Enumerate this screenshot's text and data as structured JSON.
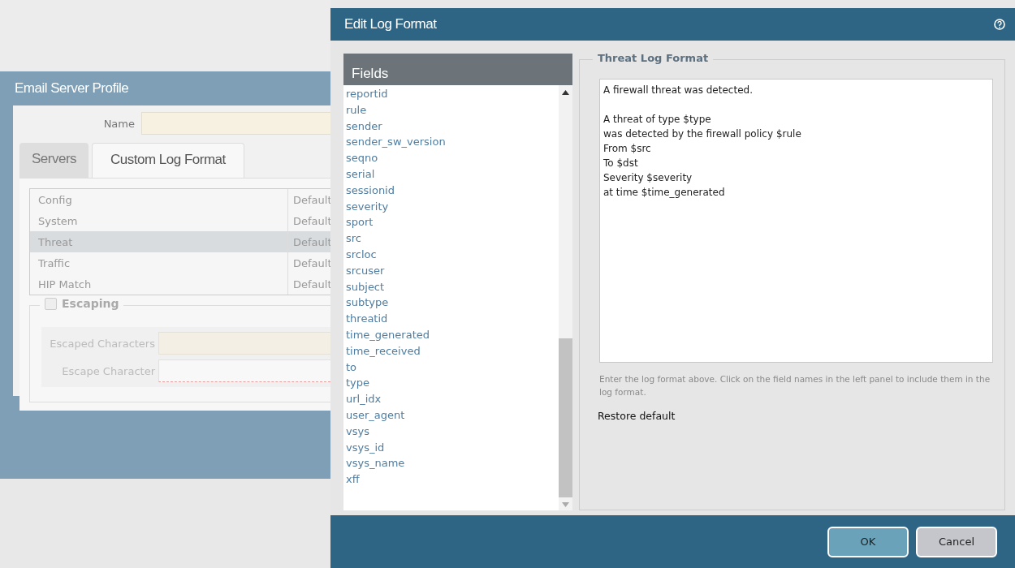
{
  "background_dialog": {
    "title": "Email Server Profile",
    "name_label": "Name",
    "tabs": [
      {
        "label": "Servers",
        "selected": false
      },
      {
        "label": "Custom Log Format",
        "selected": true
      }
    ],
    "log_types": [
      {
        "name": "Config",
        "format": "Default",
        "selected": false
      },
      {
        "name": "System",
        "format": "Default",
        "selected": false
      },
      {
        "name": "Threat",
        "format": "Default",
        "selected": true
      },
      {
        "name": "Traffic",
        "format": "Default",
        "selected": false
      },
      {
        "name": "HIP Match",
        "format": "Default",
        "selected": false
      }
    ],
    "escaping": {
      "label": "Escaping",
      "checked": false
    },
    "escaped_characters_label": "Escaped Characters",
    "escape_character_label": "Escape Character"
  },
  "modal": {
    "title": "Edit Log Format",
    "fields_header": "Fields",
    "fields": [
      "reportid",
      "rule",
      "sender",
      "sender_sw_version",
      "seqno",
      "serial",
      "sessionid",
      "severity",
      "sport",
      "src",
      "srcloc",
      "srcuser",
      "subject",
      "subtype",
      "threatid",
      "time_generated",
      "time_received",
      "to",
      "type",
      "url_idx",
      "user_agent",
      "vsys",
      "vsys_id",
      "vsys_name",
      "xff"
    ],
    "format_legend": "Threat Log Format",
    "format_text": "A firewall threat was detected.\n\nA threat of type $type\nwas detected by the firewall policy $rule\nFrom $src\nTo $dst\nSeverity $severity\nat time $time_generated",
    "hint": "Enter the log format above. Click on the field names in the left panel to include them in the log format.",
    "restore_link": "Restore default",
    "buttons": [
      {
        "label": "OK",
        "kind": "primary"
      },
      {
        "label": "Cancel",
        "kind": "secondary"
      }
    ]
  }
}
